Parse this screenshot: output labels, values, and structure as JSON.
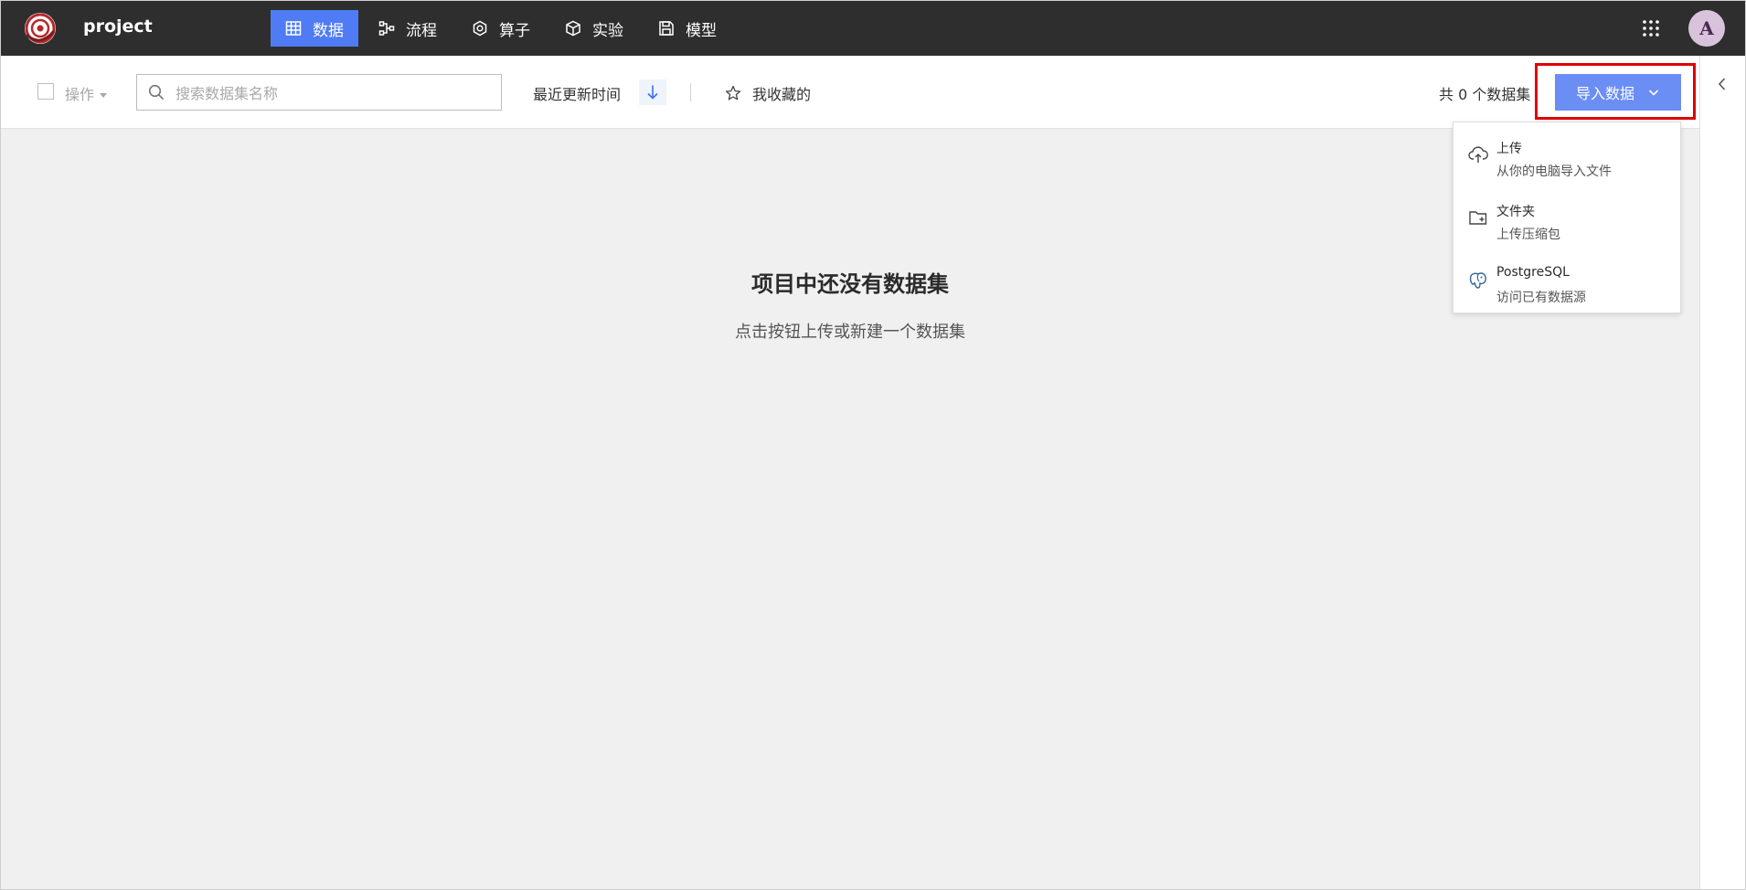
{
  "app": {
    "project_name": "project"
  },
  "nav": {
    "items": [
      {
        "label": "数据",
        "icon": "table-icon",
        "active": true
      },
      {
        "label": "流程",
        "icon": "flow-icon",
        "active": false
      },
      {
        "label": "算子",
        "icon": "operator-icon",
        "active": false
      },
      {
        "label": "实验",
        "icon": "cube-icon",
        "active": false
      },
      {
        "label": "模型",
        "icon": "save-icon",
        "active": false
      }
    ]
  },
  "user": {
    "avatar_initial": "A"
  },
  "toolbar": {
    "ops_label": "操作",
    "search_placeholder": "搜索数据集名称",
    "sort_label": "最近更新时间",
    "favorites_label": "我收藏的",
    "count_label": "共 0 个数据集",
    "import_label": "导入数据"
  },
  "empty_state": {
    "title": "项目中还没有数据集",
    "subtitle": "点击按钮上传或新建一个数据集"
  },
  "import_menu": {
    "items": [
      {
        "title": "上传",
        "desc": "从你的电脑导入文件",
        "icon": "cloud-upload-icon"
      },
      {
        "title": "文件夹",
        "desc": "上传压缩包",
        "icon": "folder-add-icon"
      },
      {
        "title": "PostgreSQL",
        "desc": "访问已有数据源",
        "icon": "postgresql-icon"
      }
    ]
  },
  "colors": {
    "topbar": "#2e2e2e",
    "accent": "#4f7cf4",
    "import_button": "#6b8ef5",
    "highlight": "#e00000",
    "background": "#f0f0f0"
  }
}
